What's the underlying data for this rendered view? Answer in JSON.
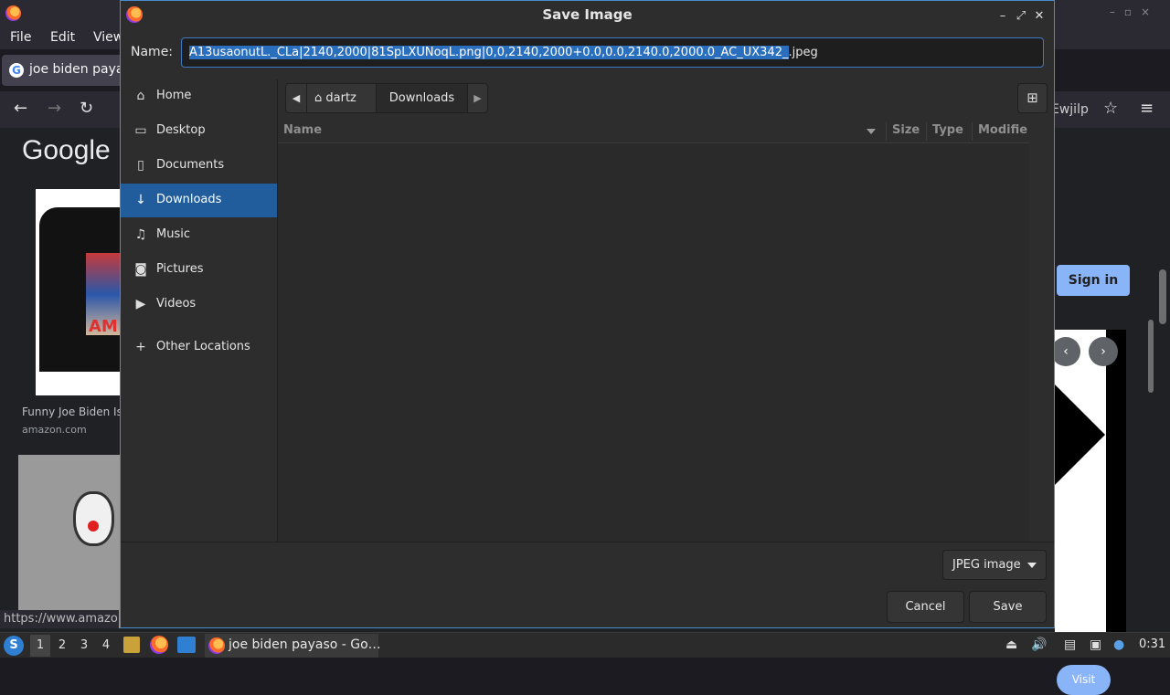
{
  "browser": {
    "menu": {
      "file": "File",
      "edit": "Edit",
      "view": "View"
    },
    "tab_title": "joe biden paya",
    "url_fragment": "Ewjilp",
    "google_logo": "Google",
    "sign_in": "Sign in",
    "result1_caption": "Funny Joe Biden Is",
    "result1_source": "amazon.com",
    "result1_print_text": "AM",
    "visit": "Visit",
    "status_url": "https://www.amazo"
  },
  "dialog": {
    "title": "Save Image",
    "name_label": "Name:",
    "name_selected": "A13usaonutL._CLa|2140,2000|81SpLXUNoqL.png|0,0,2140,2000+0.0,0.0,2140.0,2000.0_AC_UX342_",
    "name_ext": ".jpeg",
    "places": [
      {
        "label": "Home",
        "icon": "home-icon"
      },
      {
        "label": "Desktop",
        "icon": "folder-icon"
      },
      {
        "label": "Documents",
        "icon": "document-icon"
      },
      {
        "label": "Downloads",
        "icon": "download-icon"
      },
      {
        "label": "Music",
        "icon": "music-icon"
      },
      {
        "label": "Pictures",
        "icon": "camera-icon"
      },
      {
        "label": "Videos",
        "icon": "video-icon"
      },
      {
        "label": "Other Locations",
        "icon": "plus-icon"
      }
    ],
    "path": {
      "home": "dartz",
      "current": "Downloads"
    },
    "columns": {
      "name": "Name",
      "size": "Size",
      "type": "Type",
      "modified": "Modifie"
    },
    "filter": "JPEG image",
    "cancel": "Cancel",
    "save": "Save"
  },
  "taskbar": {
    "workspaces": [
      "1",
      "2",
      "3",
      "4"
    ],
    "task_title": "joe biden payaso - Go…",
    "clock": "0:31"
  },
  "colors": {
    "accent": "#215d9c",
    "selection": "#2a6fbd",
    "focus_border": "#4b8bd0"
  }
}
